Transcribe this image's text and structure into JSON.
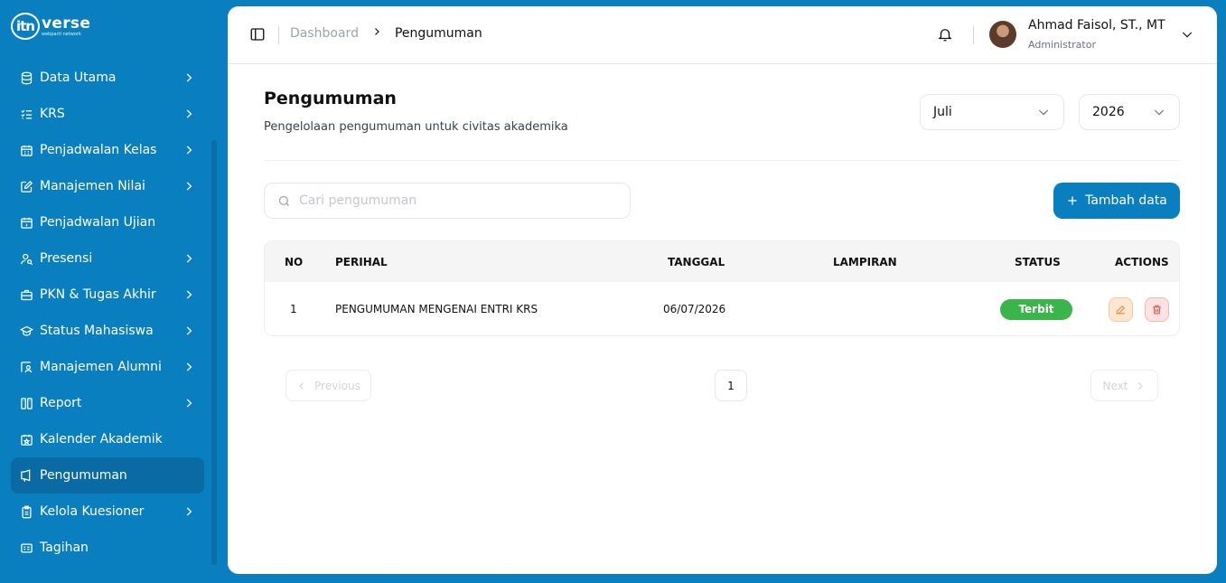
{
  "brand": {
    "name": "verse",
    "tagline": "webparti network",
    "mark": "itn"
  },
  "sidebar": {
    "items": [
      {
        "label": "Data Utama",
        "icon": "database-icon",
        "has_submenu": true
      },
      {
        "label": "KRS",
        "icon": "list-check-icon",
        "has_submenu": true
      },
      {
        "label": "Penjadwalan Kelas",
        "icon": "calendar-grid-icon",
        "has_submenu": true
      },
      {
        "label": "Manajemen Nilai",
        "icon": "edit-square-icon",
        "has_submenu": true
      },
      {
        "label": "Penjadwalan Ujian",
        "icon": "calendar-icon",
        "has_submenu": false
      },
      {
        "label": "Presensi",
        "icon": "user-search-icon",
        "has_submenu": true
      },
      {
        "label": "PKN & Tugas Akhir",
        "icon": "briefcase-icon",
        "has_submenu": true
      },
      {
        "label": "Status Mahasiswa",
        "icon": "graduation-cap-icon",
        "has_submenu": true
      },
      {
        "label": "Manajemen Alumni",
        "icon": "user-frame-icon",
        "has_submenu": true
      },
      {
        "label": "Report",
        "icon": "report-icon",
        "has_submenu": true
      },
      {
        "label": "Kalender Akademik",
        "icon": "calendar-star-icon",
        "has_submenu": false
      },
      {
        "label": "Pengumuman",
        "icon": "megaphone-icon",
        "has_submenu": false,
        "active": true
      },
      {
        "label": "Kelola Kuesioner",
        "icon": "clipboard-icon",
        "has_submenu": true
      },
      {
        "label": "Tagihan",
        "icon": "invoice-icon",
        "has_submenu": false
      }
    ]
  },
  "header": {
    "breadcrumb": [
      "Dashboard",
      "Pengumuman"
    ],
    "user": {
      "name": "Ahmad Faisol, ST., MT",
      "role": "Administrator"
    }
  },
  "page": {
    "title": "Pengumuman",
    "subtitle": "Pengelolaan pengumuman untuk civitas akademika",
    "filters": {
      "month": "Juli",
      "year": "2026"
    },
    "search_placeholder": "Cari pengumuman",
    "add_label": "Tambah data"
  },
  "table": {
    "columns": [
      "NO",
      "PERIHAL",
      "TANGGAL",
      "LAMPIRAN",
      "STATUS",
      "ACTIONS"
    ],
    "rows": [
      {
        "no": "1",
        "perihal": "PENGUMUMAN MENGENAI ENTRI KRS",
        "tanggal": "06/07/2026",
        "lampiran": "",
        "status": "Terbit"
      }
    ]
  },
  "pagination": {
    "previous": "Previous",
    "next": "Next",
    "current_page": "1"
  },
  "colors": {
    "primary": "#0a7fc0",
    "status_green": "#3ab54a",
    "edit": "#f08a2a",
    "delete": "#e25555"
  }
}
